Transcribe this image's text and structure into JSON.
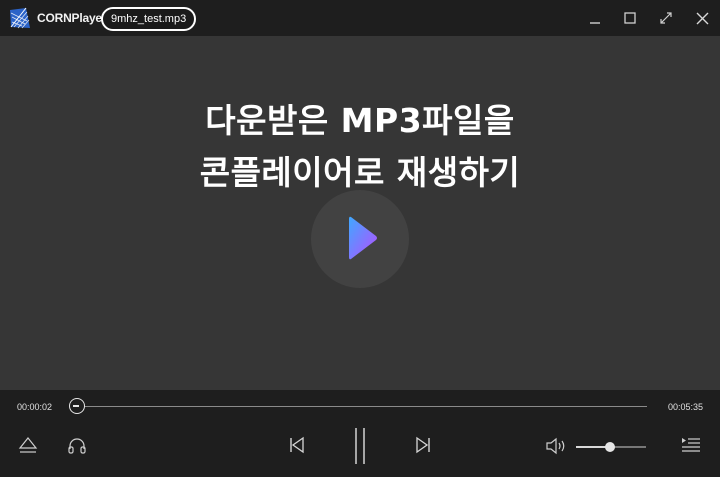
{
  "titlebar": {
    "app_name": "CORNPlayer",
    "file_name": "9mhz_test.mp3"
  },
  "video": {
    "overlay_line1": "다운받은 MP3파일을",
    "overlay_line2": "콘플레이어로 재생하기"
  },
  "playback": {
    "current_time": "00:00:02",
    "total_time": "00:05:35",
    "progress": 0.006,
    "volume": 0.5
  },
  "icons": {
    "logo": "cornplayer-logo",
    "minimize": "minimize-icon",
    "maximize": "maximize-icon",
    "fullscreen": "fullscreen-icon",
    "close": "close-icon",
    "play": "play-icon",
    "eject": "eject-icon",
    "audio": "headphones-icon",
    "prev": "previous-icon",
    "pause": "pause-icon",
    "next": "next-icon",
    "volume": "volume-icon",
    "playlist": "playlist-icon"
  },
  "colors": {
    "background": "#1e1e1e",
    "video": "#363636",
    "play_gradient_start": "#3fa8ff",
    "play_gradient_end": "#b84dff"
  }
}
